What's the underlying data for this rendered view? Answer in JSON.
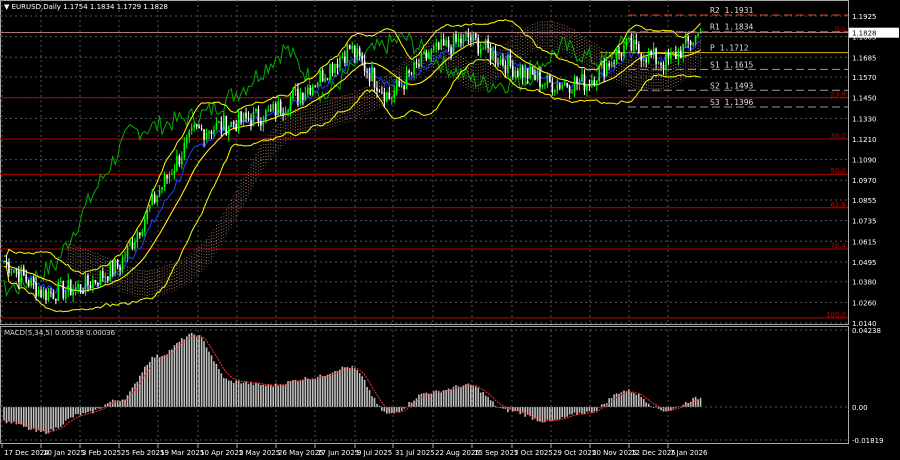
{
  "header": {
    "symbol": "EURUSD,Daily",
    "open": "1.1754",
    "high": "1.1834",
    "low": "1.1729",
    "close": "1.1828",
    "menu_icon": "triangle-down-icon"
  },
  "macd_header": {
    "label": "MACD(5,34,5)",
    "value1": "0.00538",
    "value2": "0.00036"
  },
  "colors": {
    "background": "#000000",
    "bull": "#00ff00",
    "bear": "#ffffff",
    "bands": "#ffff00",
    "fib": "#c00000",
    "pivot": "#d4c090",
    "macd_signal": "#ff3030",
    "macd_hist": "#c0c0c0",
    "chikou": "#00b000"
  },
  "chart_data": [
    {
      "type": "candlestick",
      "symbol": "EURUSD",
      "timeframe": "Daily",
      "ylim": [
        1.014,
        1.1925
      ],
      "y_ticks": [
        "1.1925",
        "1.1805",
        "1.1685",
        "1.1570",
        "1.1450",
        "1.1330",
        "1.1210",
        "1.1090",
        "1.0970",
        "1.0855",
        "1.0735",
        "1.0615",
        "1.0495",
        "1.0380",
        "1.0260",
        "1.0140"
      ],
      "x_ticks": [
        "17 Dec 2024",
        "10 Jan 2025",
        "3 Feb 2025",
        "25 Feb 2025",
        "19 Mar 2025",
        "10 Apr 2025",
        "2 May 2025",
        "26 May 2025",
        "17 Jun 2025",
        "9 Jul 2025",
        "31 Jul 2025",
        "22 Aug 2025",
        "15 Sep 2025",
        "7 Oct 2025",
        "29 Oct 2025",
        "20 Nov 2025",
        "12 Dec 2025",
        "7 Jan 2026"
      ],
      "close_path": [
        {
          "date": "17 Dec 2024",
          "close": 1.05
        },
        {
          "date": "10 Jan 2025",
          "close": 1.031
        },
        {
          "date": "3 Feb 2025",
          "close": 1.035
        },
        {
          "date": "25 Feb 2025",
          "close": 1.048
        },
        {
          "date": "19 Mar 2025",
          "close": 1.089
        },
        {
          "date": "10 Apr 2025",
          "close": 1.125
        },
        {
          "date": "2 May 2025",
          "close": 1.13
        },
        {
          "date": "26 May 2025",
          "close": 1.136
        },
        {
          "date": "17 Jun 2025",
          "close": 1.152
        },
        {
          "date": "9 Jul 2025",
          "close": 1.174
        },
        {
          "date": "31 Jul 2025",
          "close": 1.145
        },
        {
          "date": "22 Aug 2025",
          "close": 1.17
        },
        {
          "date": "15 Sep 2025",
          "close": 1.18
        },
        {
          "date": "7 Oct 2025",
          "close": 1.164
        },
        {
          "date": "29 Oct 2025",
          "close": 1.153
        },
        {
          "date": "20 Nov 2025",
          "close": 1.154
        },
        {
          "date": "12 Dec 2025",
          "close": 1.175
        },
        {
          "date": "7 Jan 2026",
          "close": 1.165
        },
        {
          "date": "last",
          "close": 1.1828
        }
      ],
      "current_price": "1.1828",
      "pivots": [
        {
          "label": "R2",
          "value": "1.1931"
        },
        {
          "label": "R1",
          "value": "1.1834"
        },
        {
          "label": "P",
          "value": "1.1712"
        },
        {
          "label": "S1",
          "value": "1.1615"
        },
        {
          "label": "S2",
          "value": "1.1493"
        },
        {
          "label": "S3",
          "value": "1.1396"
        }
      ],
      "fibonacci": [
        {
          "label": "0.0",
          "price": 1.1828
        },
        {
          "label": "23.6",
          "price": 1.145
        },
        {
          "label": "38.2",
          "price": 1.121
        },
        {
          "label": "50.0",
          "price": 1.1005
        },
        {
          "label": "61.8",
          "price": 1.081
        },
        {
          "label": "76.4",
          "price": 1.057
        },
        {
          "label": "100.0",
          "price": 1.017
        }
      ]
    },
    {
      "type": "histogram",
      "name": "MACD(5,34,5)",
      "ylim": [
        -0.01819,
        0.04238
      ],
      "y_ticks": [
        "0.04238",
        "0.00",
        "-0.01819"
      ],
      "path": [
        {
          "date": "17 Dec 2024",
          "value": -0.008
        },
        {
          "date": "10 Jan 2025",
          "value": -0.014
        },
        {
          "date": "3 Feb 2025",
          "value": -0.004
        },
        {
          "date": "25 Feb 2025",
          "value": 0.004
        },
        {
          "date": "19 Mar 2025",
          "value": 0.028
        },
        {
          "date": "10 Apr 2025",
          "value": 0.04
        },
        {
          "date": "2 May 2025",
          "value": 0.014
        },
        {
          "date": "26 May 2025",
          "value": 0.012
        },
        {
          "date": "17 Jun 2025",
          "value": 0.016
        },
        {
          "date": "9 Jul 2025",
          "value": 0.022
        },
        {
          "date": "31 Jul 2025",
          "value": -0.004
        },
        {
          "date": "22 Aug 2025",
          "value": 0.008
        },
        {
          "date": "15 Sep 2025",
          "value": 0.012
        },
        {
          "date": "7 Oct 2025",
          "value": -0.002
        },
        {
          "date": "29 Oct 2025",
          "value": -0.008
        },
        {
          "date": "20 Nov 2025",
          "value": -0.003
        },
        {
          "date": "12 Dec 2025",
          "value": 0.009
        },
        {
          "date": "7 Jan 2026",
          "value": -0.002
        },
        {
          "date": "last",
          "value": 0.005
        }
      ]
    }
  ]
}
